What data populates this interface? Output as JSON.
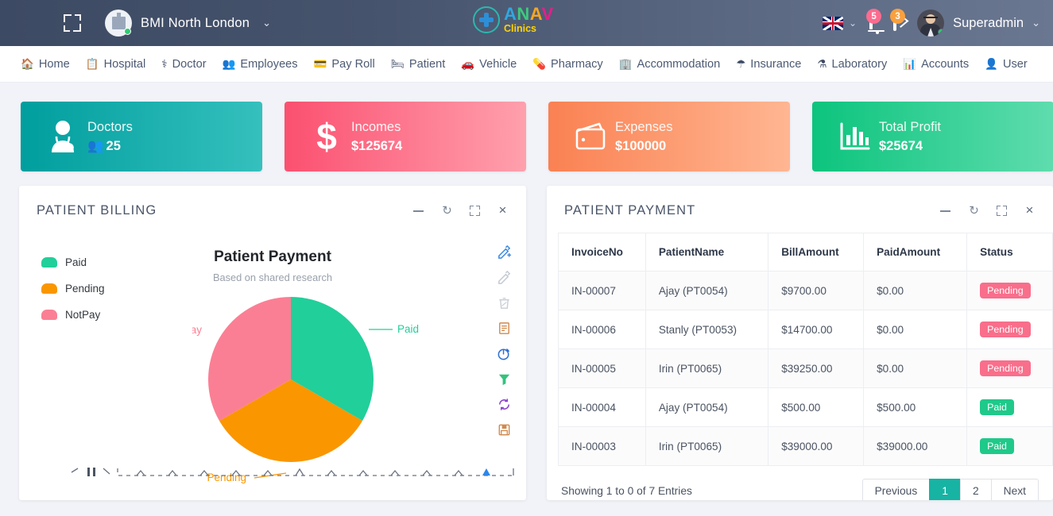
{
  "header": {
    "menu_icon": "hamburger-icon",
    "fullscreen_icon": "fullscreen-icon",
    "hospital_name": "BMI North London",
    "hospital_caret": "⌄",
    "logo": {
      "l1": "A",
      "l2": "N",
      "l3": "A",
      "l4": "V",
      "sub": "Clinics"
    },
    "language_flag": "uk-flag-icon",
    "language_caret": "⌄",
    "notification_count": "5",
    "message_count": "3",
    "user_name": "Superadmin",
    "user_caret": "⌄"
  },
  "nav": {
    "items": [
      {
        "label": "Home",
        "icon": "🏠"
      },
      {
        "label": "Hospital",
        "icon": "📋"
      },
      {
        "label": "Doctor",
        "icon": "⚕"
      },
      {
        "label": "Employees",
        "icon": "👥"
      },
      {
        "label": "Pay Roll",
        "icon": "💳"
      },
      {
        "label": "Patient",
        "icon": "🛏"
      },
      {
        "label": "Vehicle",
        "icon": "🚗"
      },
      {
        "label": "Pharmacy",
        "icon": "💊"
      },
      {
        "label": "Accommodation",
        "icon": "🏢"
      },
      {
        "label": "Insurance",
        "icon": "☂"
      },
      {
        "label": "Laboratory",
        "icon": "⚗"
      },
      {
        "label": "Accounts",
        "icon": "📊"
      },
      {
        "label": "User",
        "icon": "👤"
      }
    ]
  },
  "cards": [
    {
      "title": "Doctors",
      "value": "25",
      "icon": "doctor-icon",
      "color": "#009e9e"
    },
    {
      "title": "Incomes",
      "value": "$125674",
      "icon": "dollar-icon",
      "color": "#fb5070"
    },
    {
      "title": "Expenses",
      "value": "$100000",
      "icon": "wallet-icon",
      "color": "#fa8152"
    },
    {
      "title": "Total Profit",
      "value": "$25674",
      "icon": "barchart-icon",
      "color": "#0cc47d"
    }
  ],
  "billing_panel": {
    "title": "PATIENT BILLING",
    "tools": [
      "minimize",
      "refresh",
      "expand",
      "close"
    ],
    "toolbar_icons": [
      "pencil-add-icon",
      "pencil-edit-icon",
      "trash-icon",
      "document-icon",
      "pie-chart-icon",
      "funnel-icon",
      "refresh-cycle-icon",
      "save-disk-icon"
    ]
  },
  "chart_data": {
    "type": "pie",
    "title": "Patient Payment",
    "subtitle": "Based on shared research",
    "categories": [
      "Paid",
      "Pending",
      "NotPay"
    ],
    "values": [
      33.33,
      33.33,
      33.34
    ],
    "colors": [
      "#21cf9a",
      "#fa9600",
      "#fb7f94"
    ],
    "labels": [
      "Paid",
      "Pending",
      "NotPay"
    ],
    "legend_position": "left",
    "grid": false
  },
  "payment_panel": {
    "title": "PATIENT PAYMENT",
    "tools": [
      "minimize",
      "refresh",
      "expand",
      "close"
    ],
    "columns": [
      "InvoiceNo",
      "PatientName",
      "BillAmount",
      "PaidAmount",
      "Status"
    ],
    "rows": [
      {
        "invoice": "IN-00007",
        "patient": "Ajay (PT0054)",
        "bill": "$9700.00",
        "paid": "$0.00",
        "status": "Pending",
        "status_kind": "pending"
      },
      {
        "invoice": "IN-00006",
        "patient": "Stanly (PT0053)",
        "bill": "$14700.00",
        "paid": "$0.00",
        "status": "Pending",
        "status_kind": "pending"
      },
      {
        "invoice": "IN-00005",
        "patient": "Irin (PT0065)",
        "bill": "$39250.00",
        "paid": "$0.00",
        "status": "Pending",
        "status_kind": "pending"
      },
      {
        "invoice": "IN-00004",
        "patient": "Ajay (PT0054)",
        "bill": "$500.00",
        "paid": "$500.00",
        "status": "Paid",
        "status_kind": "paid"
      },
      {
        "invoice": "IN-00003",
        "patient": "Irin (PT0065)",
        "bill": "$39000.00",
        "paid": "$39000.00",
        "status": "Paid",
        "status_kind": "paid"
      }
    ],
    "showing": "Showing 1 to 0 of 7 Entries",
    "pager": {
      "previous": "Previous",
      "pages": [
        "1",
        "2"
      ],
      "active": "1",
      "next": "Next"
    }
  },
  "colors": {
    "accent_teal": "#17b3a3",
    "paid": "#1fc98a",
    "pending": "#f96e8b",
    "header_bg": "#46536c"
  }
}
